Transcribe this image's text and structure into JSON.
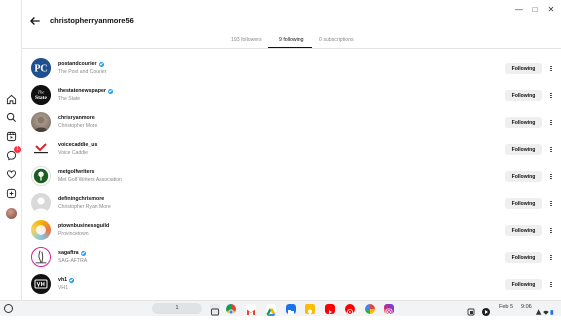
{
  "app": {
    "title": "christopherryanmore56",
    "window_controls": [
      "minimize-icon",
      "maximize-icon",
      "close-icon"
    ]
  },
  "rail": {
    "notification_count": "1",
    "icons": [
      "home-icon",
      "search-icon",
      "reels-icon",
      "messenger-icon",
      "heart-icon",
      "create-icon",
      "profile-avatar"
    ]
  },
  "tabs": [
    {
      "label": "193 followers",
      "active": false
    },
    {
      "label": "9 following",
      "active": true
    },
    {
      "label": "0 subscriptions",
      "active": false
    }
  ],
  "accounts": [
    {
      "username": "postandcourier",
      "name": "The Post and Courier",
      "verified": true,
      "button": "Following"
    },
    {
      "username": "thestatenewspaper",
      "name": "The State",
      "verified": true,
      "button": "Following"
    },
    {
      "username": "chrisryanmore",
      "name": "Christopher More",
      "verified": false,
      "button": "Following"
    },
    {
      "username": "voicecaddie_us",
      "name": "Voice Caddie",
      "verified": false,
      "button": "Following"
    },
    {
      "username": "metgolfwriters",
      "name": "Met Golf Writers Association",
      "verified": false,
      "button": "Following"
    },
    {
      "username": "definingchrismore",
      "name": "Christopher Ryan More",
      "verified": false,
      "button": "Following"
    },
    {
      "username": "ptownbusinessguild",
      "name": "Provincetown",
      "verified": false,
      "button": "Following"
    },
    {
      "username": "sagaftra",
      "name": "SAG-AFTRA",
      "verified": true,
      "button": "Following"
    },
    {
      "username": "vh1",
      "name": "VH1",
      "verified": true,
      "button": "Following"
    }
  ],
  "shelf": {
    "desk_number": "1",
    "date": "Feb 5",
    "time": "9:06",
    "apps": [
      "chrome-icon",
      "gmail-icon",
      "drive-icon",
      "files-icon",
      "keep-icon",
      "youtube-icon",
      "youtube-music-icon",
      "photos-icon",
      "instagram-icon"
    ]
  }
}
